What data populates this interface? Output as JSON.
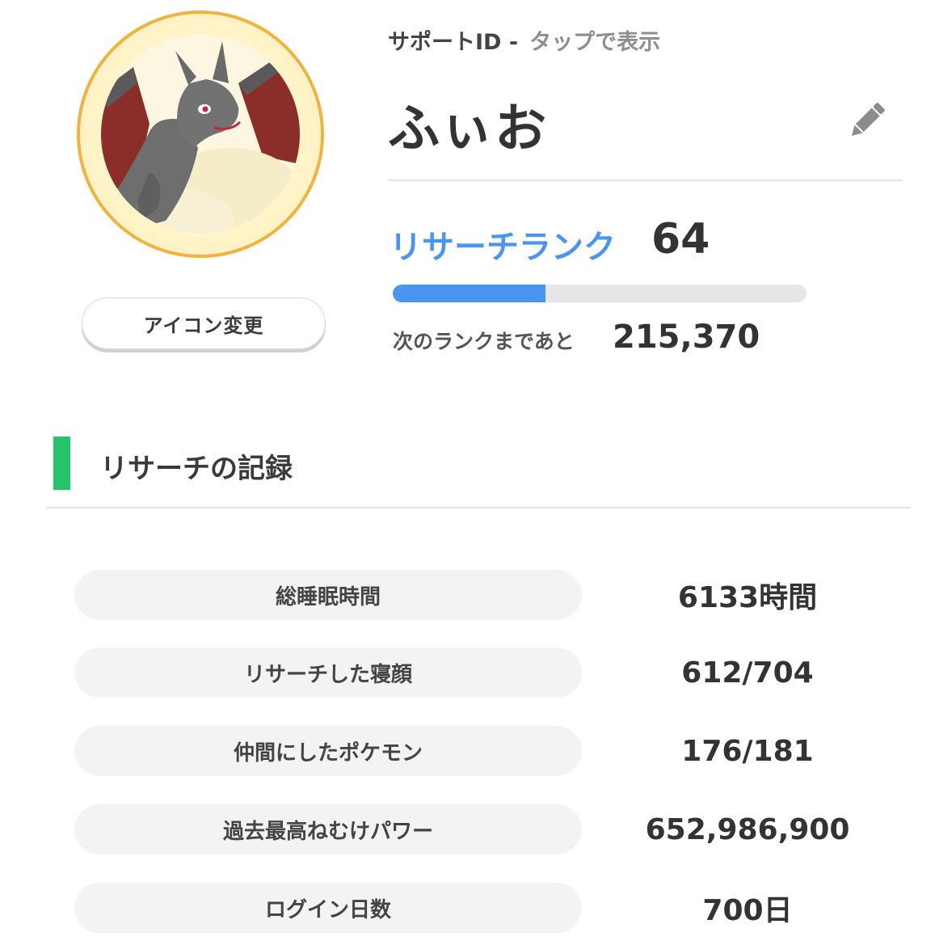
{
  "profile": {
    "support_id_label": "サポートID -",
    "support_id_tap": "タップで表示",
    "name": "ふぃお",
    "change_icon_label": "アイコン変更"
  },
  "rank": {
    "label": "リサーチランク",
    "value": "64",
    "progress_fraction": 0.37,
    "next_label": "次のランクまであと",
    "next_value": "215,370"
  },
  "section": {
    "title": "リサーチの記録"
  },
  "stats": [
    {
      "label": "総睡眠時間",
      "value": "6133時間"
    },
    {
      "label": "リサーチした寝顔",
      "value": "612/704"
    },
    {
      "label": "仲間にしたポケモン",
      "value": "176/181"
    },
    {
      "label": "過去最高ねむけパワー",
      "value": "652,986,900"
    },
    {
      "label": "ログイン日数",
      "value": "700日"
    }
  ],
  "colors": {
    "accent_blue": "#4a95f0",
    "section_green": "#25c46a",
    "ring_orange": "#f3b23a"
  },
  "icons": {
    "avatar": "charizard-avatar-icon",
    "edit": "pencil-icon"
  }
}
